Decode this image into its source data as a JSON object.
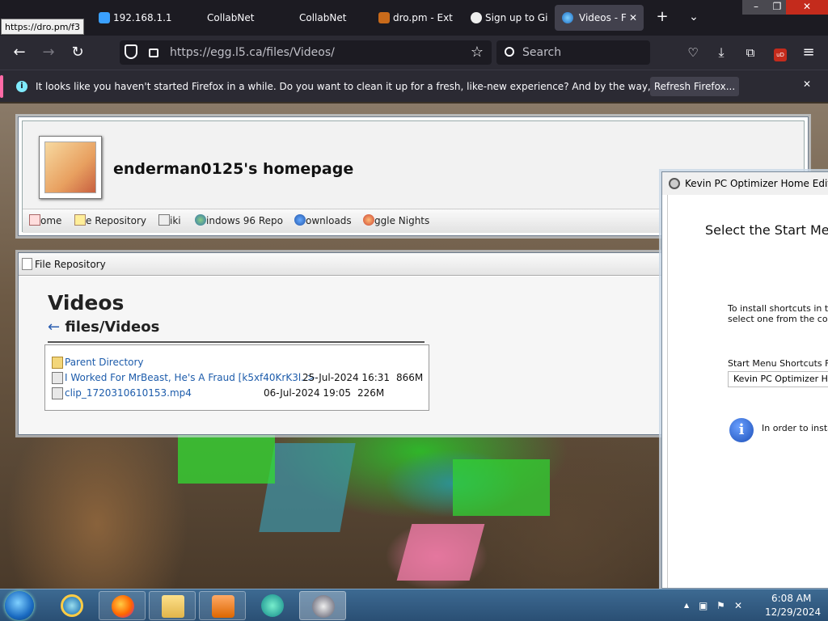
{
  "browser": {
    "tooltip": "https://dro.pm/f3",
    "tabs": [
      {
        "label": "192.168.1.1"
      },
      {
        "label": "CollabNet"
      },
      {
        "label": "CollabNet"
      },
      {
        "label": "dro.pm - Ext"
      },
      {
        "label": "Sign up to Gi"
      },
      {
        "label": "Videos - F"
      }
    ],
    "new_tab": "+",
    "url": "https://egg.l5.ca/files/Videos/",
    "search_placeholder": "Search",
    "notification": "It looks like you haven't started Firefox in a while. Do you want to clean it up for a fresh, like-new experience? And by the way, welcome back!",
    "refresh_button": "Refresh Firefox...",
    "window_controls": {
      "minimize": "–",
      "maximize": "❐",
      "close": "✕"
    },
    "close_notif": "✕",
    "ublock": "uD"
  },
  "homepage": {
    "title": "enderman0125's homepage",
    "nav": [
      "ome",
      "e Repository",
      "iki",
      "indows 96 Repo",
      "ownloads",
      "ggle Nights"
    ]
  },
  "file_repository": {
    "window_title": "File Repository",
    "heading": "Videos",
    "back_arrow": "←",
    "path": "files/Videos",
    "rows": [
      {
        "name": "Parent Directory",
        "date": "",
        "size": ""
      },
      {
        "name": "I Worked For MrBeast, He's A Fraud [k5xf40KrK3l..>",
        "date": "25-Jul-2024 16:31",
        "size": "866M"
      },
      {
        "name": "clip_1720310610153.mp4",
        "date": "06-Jul-2024 19:05",
        "size": "226M"
      }
    ]
  },
  "optimizer": {
    "title": "Kevin PC Optimizer Home Edition",
    "heading": "Select the Start Men",
    "text_line1": "To install shortcuts in th",
    "text_line2": "select one from the comb",
    "folder_label": "Start Menu Shortcuts Fo",
    "folder_value": "Kevin PC Optimizer Hom",
    "info_note": "In order to insta"
  },
  "taskbar": {
    "time": "6:08 AM",
    "date": "12/29/2024",
    "tray_arrow": "▲"
  }
}
